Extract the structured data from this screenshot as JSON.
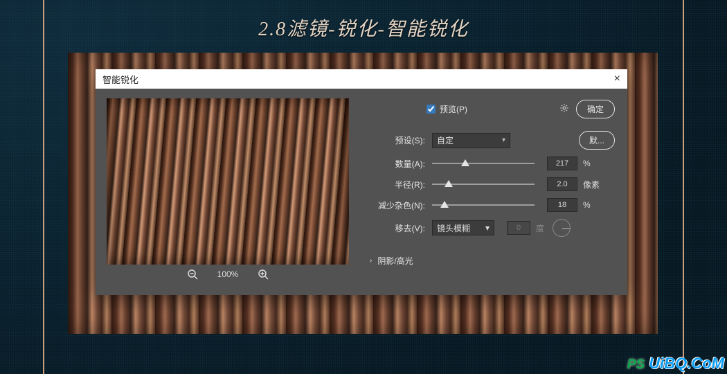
{
  "page_title": "2.8滤镜-锐化-智能锐化",
  "dialog": {
    "title": "智能锐化",
    "close": "×",
    "preview_label": "预览(P)",
    "preview_checked": true,
    "ok_label": "确定",
    "default_label": "默...",
    "preset_label": "预设(S):",
    "preset_value": "自定",
    "amount_label": "数量(A):",
    "amount_value": "217",
    "amount_unit": "%",
    "radius_label": "半径(R):",
    "radius_value": "2.0",
    "radius_unit": "像素",
    "noise_label": "减少杂色(N):",
    "noise_value": "18",
    "noise_unit": "%",
    "remove_label": "移去(V):",
    "remove_value": "镜头模糊",
    "angle_value": "0",
    "angle_unit": "度",
    "section_label": "阴影/高光",
    "zoom_out": "−",
    "zoom_value": "100%",
    "zoom_in": "+"
  },
  "watermark": {
    "ps": "PS",
    "site": "UiBQ.CoM"
  },
  "slider_positions": {
    "amount": 42,
    "radius": 18,
    "noise": 12
  }
}
